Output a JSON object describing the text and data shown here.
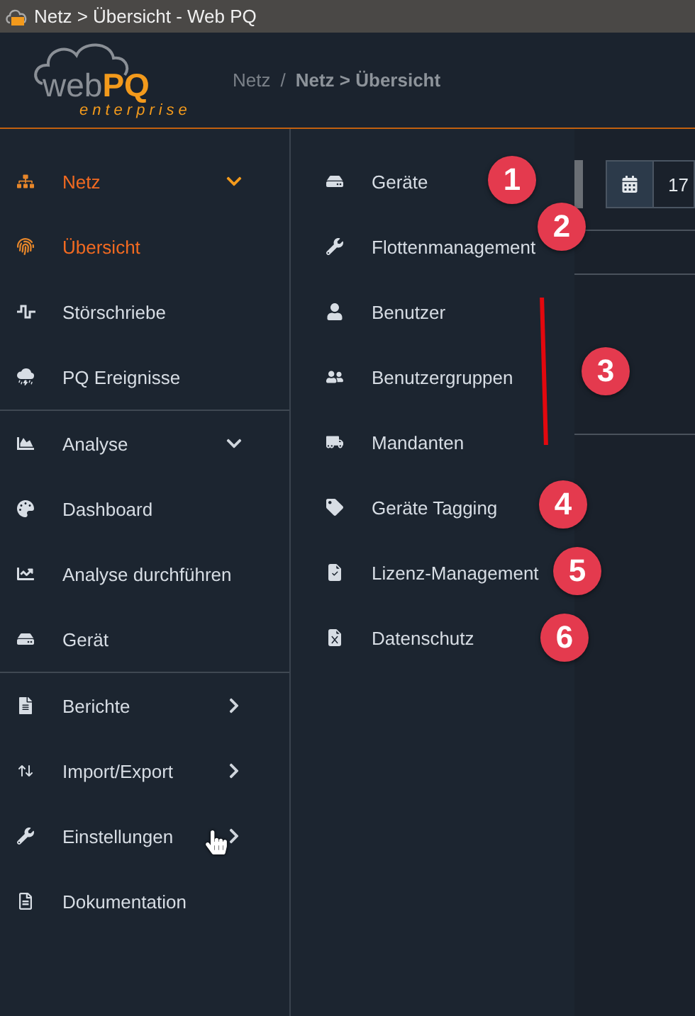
{
  "window": {
    "title": "Netz > Übersicht - Web PQ"
  },
  "logo": {
    "word": "web",
    "accent": "PQ",
    "tagline": "enterprise"
  },
  "breadcrumb": {
    "parent": "Netz",
    "separator": "/",
    "current": "Netz > Übersicht"
  },
  "sidebar": {
    "groups": [
      {
        "items": [
          {
            "label": "Netz",
            "kind": "section",
            "expanded": true,
            "selected": true
          },
          {
            "label": "Übersicht",
            "kind": "link",
            "selected": true
          },
          {
            "label": "Störschriebe",
            "kind": "link",
            "selected": false
          },
          {
            "label": "PQ Ereignisse",
            "kind": "link",
            "selected": false
          }
        ]
      },
      {
        "items": [
          {
            "label": "Analyse",
            "kind": "section",
            "expanded": true,
            "selected": false
          },
          {
            "label": "Dashboard",
            "kind": "link",
            "selected": false
          },
          {
            "label": "Analyse durchführen",
            "kind": "link",
            "selected": false
          },
          {
            "label": "Gerät",
            "kind": "link",
            "selected": false
          }
        ]
      },
      {
        "items": [
          {
            "label": "Berichte",
            "kind": "submenu",
            "selected": false
          },
          {
            "label": "Import/Export",
            "kind": "submenu",
            "selected": false
          },
          {
            "label": "Einstellungen",
            "kind": "submenu",
            "selected": false
          },
          {
            "label": "Dokumentation",
            "kind": "link",
            "selected": false
          }
        ]
      }
    ]
  },
  "submenu": {
    "items": [
      {
        "label": "Geräte"
      },
      {
        "label": "Flottenmanagement"
      },
      {
        "label": "Benutzer"
      },
      {
        "label": "Benutzergruppen"
      },
      {
        "label": "Mandanten"
      },
      {
        "label": "Geräte Tagging"
      },
      {
        "label": "Lizenz-Management"
      },
      {
        "label": "Datenschutz"
      }
    ]
  },
  "content": {
    "date_value": "17"
  },
  "annotations": [
    {
      "label": "1"
    },
    {
      "label": "2"
    },
    {
      "label": "3"
    },
    {
      "label": "4"
    },
    {
      "label": "5"
    },
    {
      "label": "6"
    }
  ]
}
